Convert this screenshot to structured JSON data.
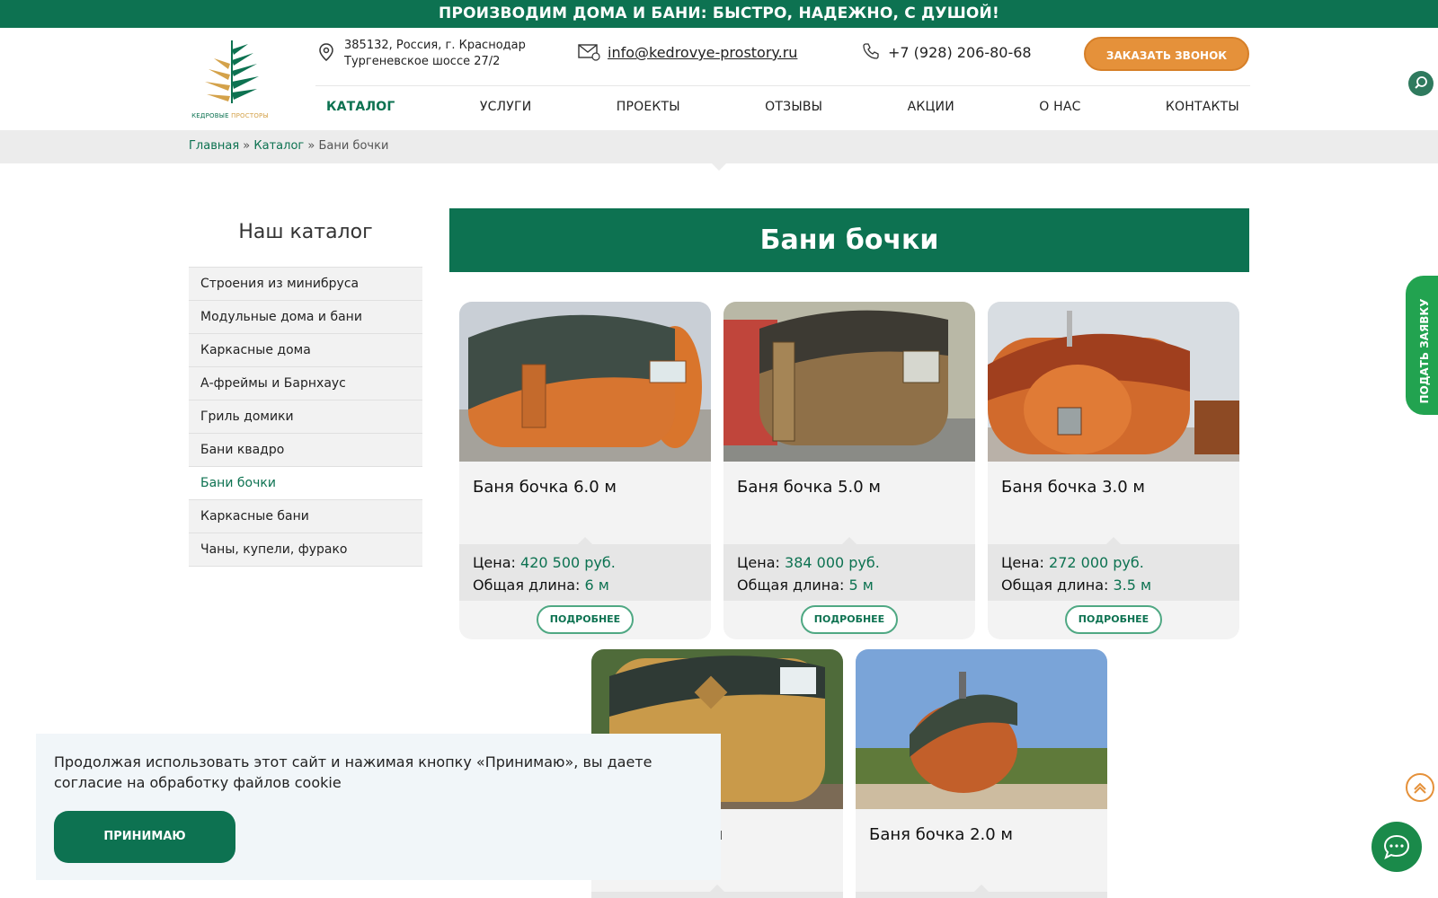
{
  "topbar": {
    "text": "ПРОИЗВОДИМ ДОМА И БАНИ: БЫСТРО, НАДЕЖНО, С ДУШОЙ!"
  },
  "logo": {
    "text_green": "КЕДРОВЫЕ",
    "text_gold": "ПРОСТОРЫ"
  },
  "contacts": {
    "address_line1": "385132, Россия, г. Краснодар",
    "address_line2": "Тургеневское шоссе 27/2",
    "email": "info@kedrovye-prostory.ru",
    "phone": "+7 (928) 206-80-68",
    "call_button": "ЗАКАЗАТЬ ЗВОНОК"
  },
  "nav": {
    "items": [
      {
        "label": "КАТАЛОГ"
      },
      {
        "label": "УСЛУГИ"
      },
      {
        "label": "ПРОЕКТЫ"
      },
      {
        "label": "ОТЗЫВЫ"
      },
      {
        "label": "АКЦИИ"
      },
      {
        "label": "О НАС"
      },
      {
        "label": "КОНТАКТЫ"
      }
    ]
  },
  "breadcrumbs": {
    "home": "Главная",
    "sep": "»",
    "catalog": "Каталог",
    "current": "Бани бочки"
  },
  "sidebar": {
    "title": "Наш каталог",
    "items": [
      {
        "label": "Строения из минибруса"
      },
      {
        "label": "Модульные дома и бани"
      },
      {
        "label": "Каркасные дома"
      },
      {
        "label": "А-фреймы и Барнхаус"
      },
      {
        "label": "Гриль домики"
      },
      {
        "label": "Бани квадро"
      },
      {
        "label": "Бани бочки"
      },
      {
        "label": "Каркасные бани"
      },
      {
        "label": "Чаны, купели, фурако"
      }
    ]
  },
  "category": {
    "title": "Бани бочки"
  },
  "products": [
    {
      "title": "Баня бочка 6.0 м",
      "price_label": "Цена:",
      "price": "420 500 руб.",
      "length_label": "Общая длина:",
      "length": "6 м",
      "button": "ПОДРОБНЕЕ"
    },
    {
      "title": "Баня бочка 5.0 м",
      "price_label": "Цена:",
      "price": "384 000 руб.",
      "length_label": "Общая длина:",
      "length": "5 м",
      "button": "ПОДРОБНЕЕ"
    },
    {
      "title": "Баня бочка 3.0 м",
      "price_label": "Цена:",
      "price": "272 000 руб.",
      "length_label": "Общая длина:",
      "length": "3.5 м",
      "button": "ПОДРОБНЕЕ"
    },
    {
      "title": "Баня бочка 2.0 м"
    }
  ],
  "partial_card_title": ") м",
  "cookie": {
    "text": "Продолжая использовать этот сайт и нажимая кнопку «Принимаю», вы даете согласие на обработку файлов cookie",
    "button": "ПРИНИМАЮ"
  },
  "side_tab": {
    "label": "ПОДАТЬ ЗАЯВКУ"
  },
  "colors": {
    "brand_green": "#0d7251",
    "accent_orange": "#e5913a",
    "chat_green": "#1a8a4a"
  },
  "icons": [
    "location-pin-icon",
    "mail-icon",
    "phone-icon",
    "search-icon",
    "arrow-up-icon",
    "chat-icon"
  ]
}
